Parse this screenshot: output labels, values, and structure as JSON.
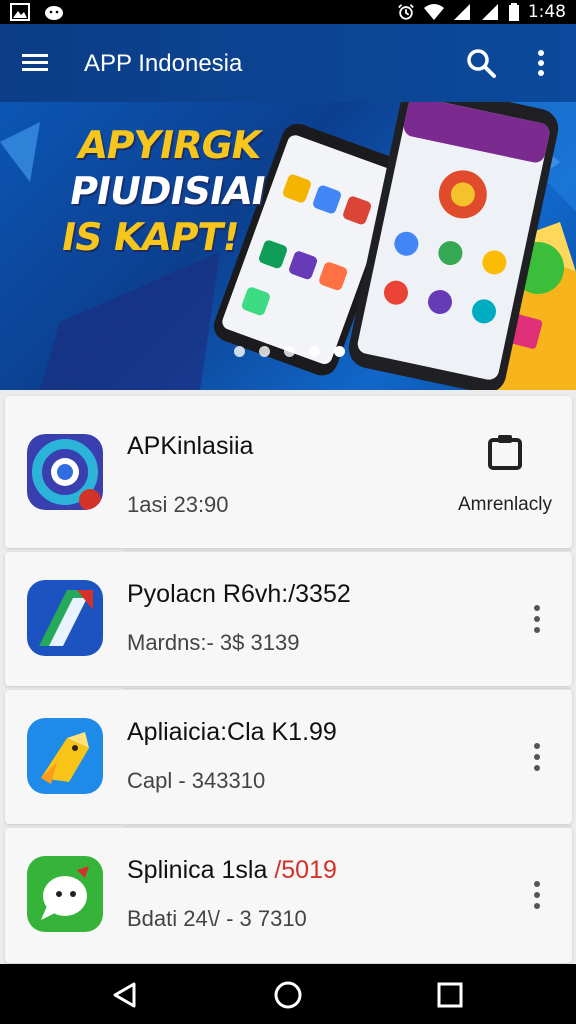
{
  "status_bar": {
    "time": "1:48"
  },
  "app_bar": {
    "title": "APP Indonesia"
  },
  "banner": {
    "headline": [
      "APYIRGK",
      "PIUDISIAI",
      "IS KAPT!"
    ],
    "slide_count": 5,
    "active_slide": 4
  },
  "apps": [
    {
      "name": "APKinlasiia",
      "meta": "1asi 23:90",
      "action": "Amrenlacly"
    },
    {
      "name_main": "Pyolacn R6vh:/3352",
      "meta": "Mardns:- 3$ 3139"
    },
    {
      "name_main": "Apliaicia:Cla K1.99",
      "meta": "Capl - 343310"
    },
    {
      "name_main": "Splinica 1sla ",
      "name_accent": "/5019",
      "meta": "Bdati 24\\/ - 3 7310"
    }
  ],
  "colors": {
    "app_bar": "#0c3d86",
    "accent_red": "#d3322b",
    "banner_yellow": "#f6c61d"
  },
  "icons": [
    "gallery-icon",
    "android-icon",
    "alarm-icon",
    "wifi-icon",
    "signal-icon",
    "battery-icon",
    "menu-icon",
    "search-icon",
    "more-vert-icon",
    "clipboard-icon",
    "back-icon",
    "home-icon",
    "recents-icon"
  ]
}
